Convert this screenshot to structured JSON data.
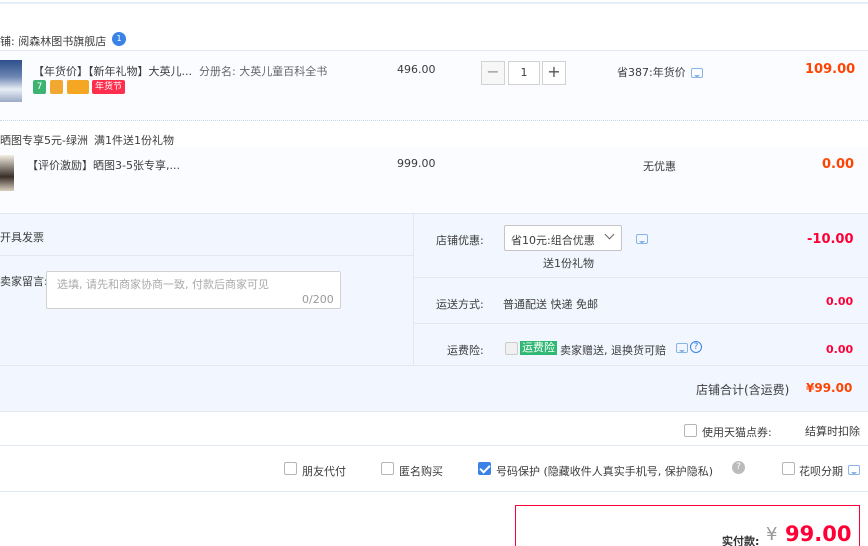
{
  "shop": {
    "name_label": "铺: 阅森林图书旗舰店",
    "badge": "1"
  },
  "item1": {
    "title": "【年货价】【新年礼物】大英儿...",
    "spec": "分册名: 大英儿童百科全书",
    "unit_price": "496.00",
    "quantity": "1",
    "minus": "−",
    "plus": "+",
    "discount": "省387:年货价",
    "total": "109.00",
    "tags": [
      "7",
      "",
      "",
      "年货节"
    ]
  },
  "promo": {
    "title": "晒图专享5元-绿洲",
    "subtitle": "满1件送1份礼物"
  },
  "item2": {
    "title": "【评价激励】晒图3-5张专享,...",
    "unit_price": "999.00",
    "discount": "无优惠",
    "total": "0.00"
  },
  "invoice": {
    "label": "开具发票"
  },
  "message": {
    "label": "卖家留言:",
    "placeholder": "选填, 请先和商家协商一致, 付款后商家可见",
    "counter": "0/200"
  },
  "shop_discount": {
    "label": "店铺优惠:",
    "selected": "省10元:组合优惠",
    "note": "送1份礼物",
    "amount": "-10.00"
  },
  "shipping": {
    "label": "运送方式:",
    "value": "普通配送 快递 免邮",
    "amount": "0.00"
  },
  "insurance": {
    "label": "运费险:",
    "badge": "运费险",
    "value": "卖家赠送, 退换货可赔",
    "amount": "0.00"
  },
  "subtotal": {
    "label": "店铺合计(含运费)",
    "amount": "¥99.00"
  },
  "points": {
    "label": "使用天猫点券:",
    "note": "结算时扣除"
  },
  "options": [
    {
      "label": "朋友代付",
      "checked": false
    },
    {
      "label": "匿名购买",
      "checked": false
    },
    {
      "label": "号码保护 (隐藏收件人真实手机号, 保护隐私)",
      "checked": true
    },
    {
      "label": "花呗分期",
      "checked": false
    }
  ],
  "payment": {
    "label": "实付款:",
    "currency": "¥",
    "amount": "99.00"
  },
  "colors": {
    "accent": "#ff4401",
    "red": "#ff0036",
    "blue": "#3b82e6",
    "border": "#dfe8f3"
  }
}
